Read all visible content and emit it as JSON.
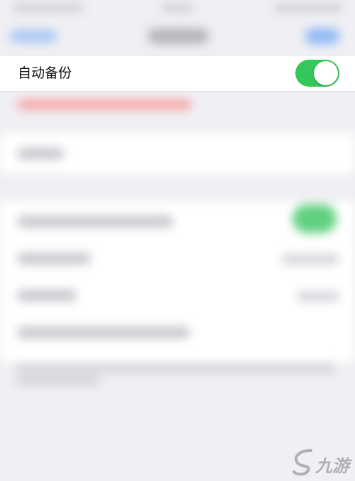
{
  "setting": {
    "label": "自动备份",
    "enabled": true
  },
  "colors": {
    "switch_on": "#34c759",
    "background": "#f0f0f4"
  },
  "watermark": {
    "text": "九游"
  }
}
